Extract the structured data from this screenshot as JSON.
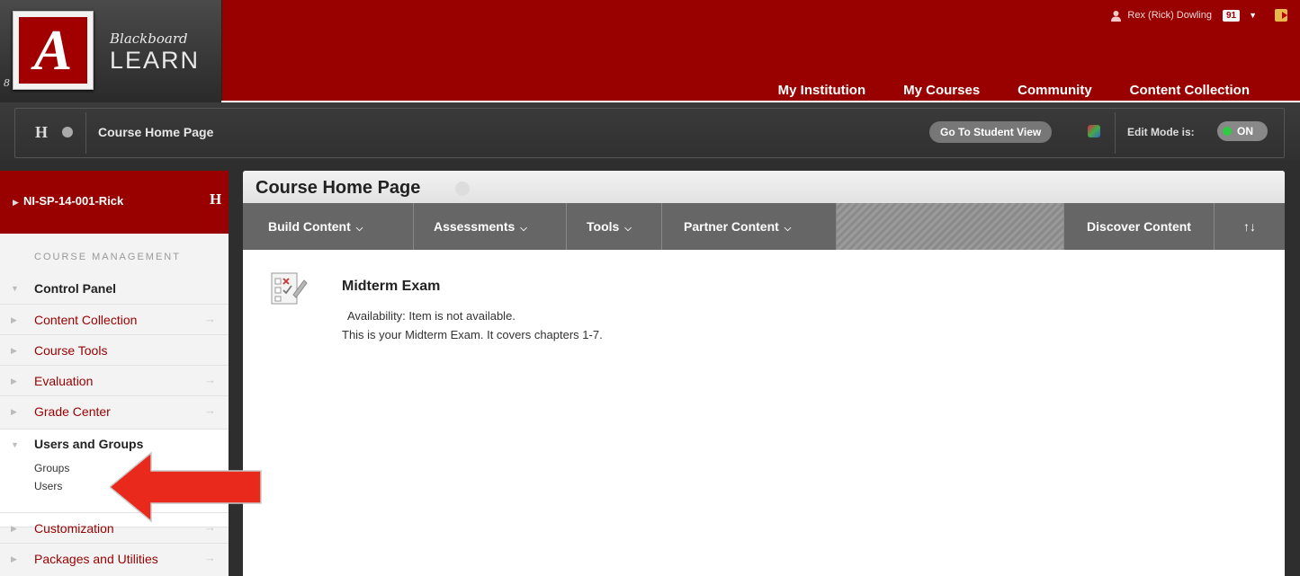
{
  "brand": {
    "logo_letter": "A",
    "blackboard": "Blackboard",
    "learn": "LEARN",
    "tag": "8"
  },
  "user": {
    "name": "Rex (Rick) Dowling",
    "notification_count": "91"
  },
  "tabs": [
    {
      "label": "My Institution"
    },
    {
      "label": "My Courses"
    },
    {
      "label": "Community"
    },
    {
      "label": "Content Collection"
    }
  ],
  "course_bar": {
    "h_label": "H",
    "breadcrumb": "Course Home Page",
    "student_view": "Go To Student View",
    "edit_mode_label": "Edit Mode is:",
    "edit_mode_state": "ON"
  },
  "left_nav": {
    "course_title": "NI-SP-14-001-Rick",
    "course_h": "H",
    "section_heading": "COURSE MANAGEMENT",
    "control_panel": "Control Panel",
    "items": [
      {
        "label": "Content Collection"
      },
      {
        "label": "Course Tools"
      },
      {
        "label": "Evaluation"
      },
      {
        "label": "Grade Center"
      }
    ],
    "users_and_groups": "Users and Groups",
    "sub_items": [
      {
        "label": "Groups"
      },
      {
        "label": "Users"
      }
    ],
    "bottom_items": [
      {
        "label": "Customization"
      },
      {
        "label": "Packages and Utilities"
      }
    ]
  },
  "main": {
    "title": "Course Home Page",
    "actions": [
      {
        "label": "Build Content"
      },
      {
        "label": "Assessments"
      },
      {
        "label": "Tools"
      },
      {
        "label": "Partner Content"
      }
    ],
    "discover": "Discover Content",
    "sort_icon": "↑↓",
    "item": {
      "title": "Midterm Exam",
      "availability": "Availability:  Item is not available.",
      "description": "This is your Midterm Exam.  It covers chapters 1-7."
    }
  },
  "colors": {
    "brand_red": "#990000",
    "arrow_red": "#e8291c"
  }
}
